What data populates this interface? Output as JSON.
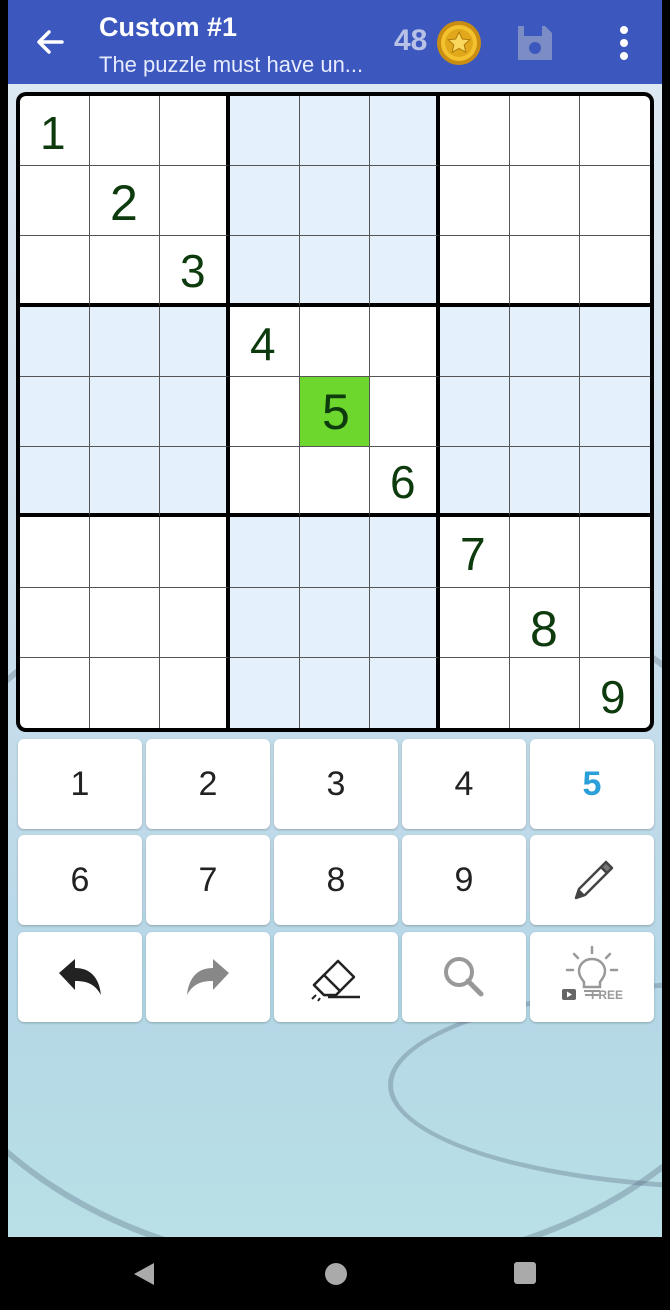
{
  "toolbar": {
    "title": "Custom #1",
    "subtitle": "The puzzle must have un...",
    "coins": "48",
    "icons": {
      "back": "arrow-back-icon",
      "coin": "coin-icon",
      "save": "save-icon",
      "menu": "more-vert-icon"
    }
  },
  "board": {
    "selected": {
      "row": 5,
      "col": 5
    },
    "givens": [
      {
        "row": 1,
        "col": 1,
        "value": "1"
      },
      {
        "row": 2,
        "col": 2,
        "value": "2"
      },
      {
        "row": 3,
        "col": 3,
        "value": "3"
      },
      {
        "row": 4,
        "col": 4,
        "value": "4"
      },
      {
        "row": 5,
        "col": 5,
        "value": "5"
      },
      {
        "row": 6,
        "col": 6,
        "value": "6"
      },
      {
        "row": 7,
        "col": 7,
        "value": "7"
      },
      {
        "row": 8,
        "col": 8,
        "value": "8"
      },
      {
        "row": 9,
        "col": 9,
        "value": "9"
      }
    ],
    "colors": {
      "shade": "#e5f0fd",
      "selected": "#6ed72e",
      "digit": "#0e3b0e"
    }
  },
  "keypad": {
    "digits": [
      "1",
      "2",
      "3",
      "4",
      "5",
      "6",
      "7",
      "8",
      "9"
    ],
    "active_digit": "5",
    "active_color": "#2b9fd8",
    "tools": {
      "pencil": "pencil-icon",
      "undo": "undo-icon",
      "redo": "redo-icon",
      "erase": "eraser-icon",
      "search": "magnifier-icon",
      "hint": "lightbulb-icon",
      "hint_badge": "FREE"
    }
  },
  "navbar": {
    "icons": [
      "nav-back-icon",
      "nav-home-icon",
      "nav-recents-icon"
    ]
  }
}
